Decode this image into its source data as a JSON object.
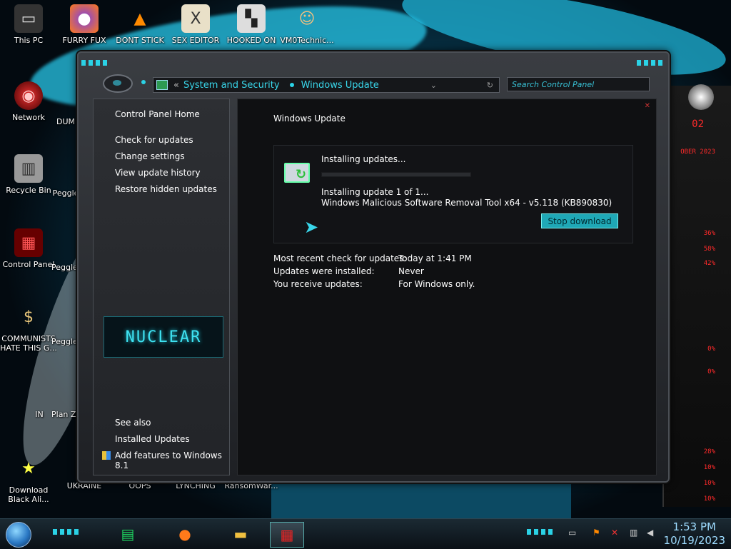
{
  "desktop": {
    "icons": [
      {
        "label": "This PC",
        "glyph": "▭"
      },
      {
        "label": "FURRY FUX",
        "glyph": "●"
      },
      {
        "label": "DONT STICK",
        "glyph": "▲"
      },
      {
        "label": "SEX EDITOR",
        "glyph": "X"
      },
      {
        "label": "HOOKED ON",
        "glyph": "▚"
      },
      {
        "label": "VM0Technic...",
        "glyph": "☺"
      },
      {
        "label": "Network",
        "glyph": "◉"
      },
      {
        "label": "Recycle Bin",
        "glyph": "▥"
      },
      {
        "label": "Control Panel",
        "glyph": "▦"
      },
      {
        "label": "COMMUNISTS HATE THIS G...",
        "glyph": "$"
      },
      {
        "label": "Download Black Ali...",
        "glyph": "★"
      },
      {
        "label": "UKRAINE",
        "glyph": "■"
      },
      {
        "label": "OOPS",
        "glyph": "■"
      },
      {
        "label": "LYNCHING",
        "glyph": "■"
      },
      {
        "label": "RansomWar...",
        "glyph": "■"
      }
    ],
    "partial_icons": [
      {
        "label": "DUM"
      },
      {
        "label": "Peggle"
      },
      {
        "label": "Peggle De"
      },
      {
        "label": "Peggle of Wa"
      },
      {
        "label": "Plan Zo"
      },
      {
        "label": "IN"
      }
    ],
    "side_readouts": [
      "02",
      "OBER 2023",
      "36%",
      "58%",
      "42%",
      "0%",
      "0%",
      "28%",
      "10%",
      "10%",
      "10%"
    ]
  },
  "window": {
    "address": {
      "back_label": "«",
      "crumbs": [
        "System and Security",
        "Windows Update"
      ],
      "dropdown_icon": "chevron-down-icon",
      "refresh_icon": "refresh-icon"
    },
    "search": {
      "placeholder": "Search Control Panel"
    },
    "nav": {
      "home": "Control Panel Home",
      "links": [
        "Check for updates",
        "Change settings",
        "View update history",
        "Restore hidden updates"
      ],
      "logo_text": "NUCLEAR",
      "see_also": "See also",
      "see_also_links": [
        "Installed Updates",
        "Add features to Windows 8.1"
      ]
    },
    "content": {
      "title": "Windows Update",
      "status": {
        "heading": "Installing updates...",
        "progress_fraction": 0.0,
        "line1": "Installing update 1 of 1...",
        "line2": "Windows Malicious Software Removal Tool x64 - v5.118 (KB890830)",
        "button": "Stop download"
      },
      "info": [
        {
          "label": "Most recent check for updates:",
          "value": "Today at 1:41 PM"
        },
        {
          "label": "Updates were installed:",
          "value": "Never"
        },
        {
          "label": "You receive updates:",
          "value": "For Windows only."
        }
      ]
    }
  },
  "taskbar": {
    "apps": [
      "notes-app",
      "firefox",
      "file-explorer",
      "control-panel"
    ],
    "clock": {
      "time": "1:53 PM",
      "date": "10/19/2023"
    }
  },
  "colors": {
    "accent": "#2bd2e6",
    "button": "#1fa8b6",
    "alert": "#ff2a2a"
  }
}
